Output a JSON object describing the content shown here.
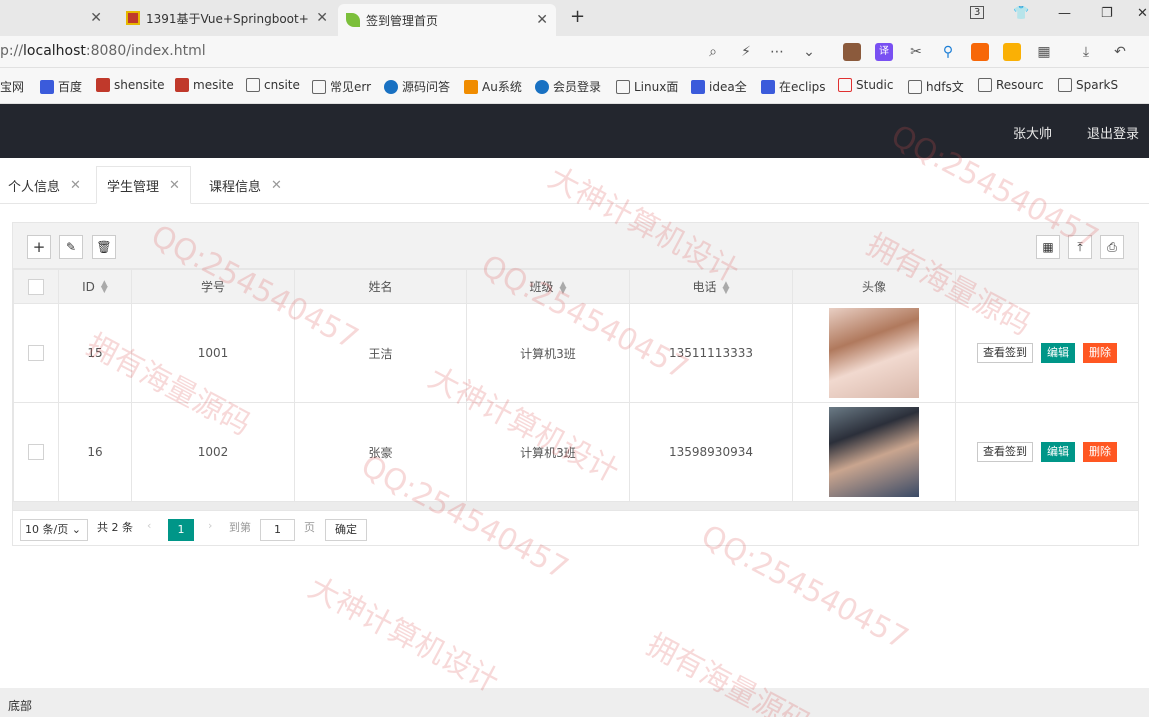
{
  "browser": {
    "tabs": [
      {
        "label": "",
        "closable": true
      },
      {
        "label": "1391基于Vue+Springboot+",
        "closable": true
      },
      {
        "label": "签到管理首页",
        "closable": true,
        "active": true
      }
    ],
    "tab_counter": "3",
    "url_prefix": "p://",
    "url_host": "localhost",
    "url_rest": ":8080/index.html",
    "bookmarks": [
      "宝网",
      "百度",
      "shensite",
      "mesite",
      "cnsite",
      "常见err",
      "源码问答",
      "Au系统",
      "会员登录",
      "Linux面",
      "idea全",
      "在eclips",
      "Studic",
      "hdfs文",
      "Resourc",
      "SparkS"
    ]
  },
  "header": {
    "user": "张大帅",
    "logout": "退出登录"
  },
  "app_tabs": [
    {
      "label": "个人信息",
      "active": false
    },
    {
      "label": "学生管理",
      "active": true
    },
    {
      "label": "课程信息",
      "active": false
    }
  ],
  "table": {
    "columns": [
      "ID",
      "学号",
      "姓名",
      "班级",
      "电话",
      "头像"
    ],
    "rows": [
      {
        "id": "15",
        "sno": "1001",
        "name": "王洁",
        "class": "计算机3班",
        "phone": "13511113333"
      },
      {
        "id": "16",
        "sno": "1002",
        "name": "张豪",
        "class": "计算机3班",
        "phone": "13598930934"
      }
    ],
    "actions": {
      "view": "查看签到",
      "edit": "编辑",
      "delete": "删除"
    }
  },
  "pager": {
    "page_size": "10 条/页",
    "total": "共 2 条",
    "current": "1",
    "goto_label": "到第",
    "goto_value": "1",
    "page_unit": "页",
    "confirm": "确定"
  },
  "footer": {
    "text": "底部"
  },
  "watermarks": {
    "qq": "QQ:254540457",
    "a": "拥有海量源码",
    "b": "大神计算机设计"
  }
}
